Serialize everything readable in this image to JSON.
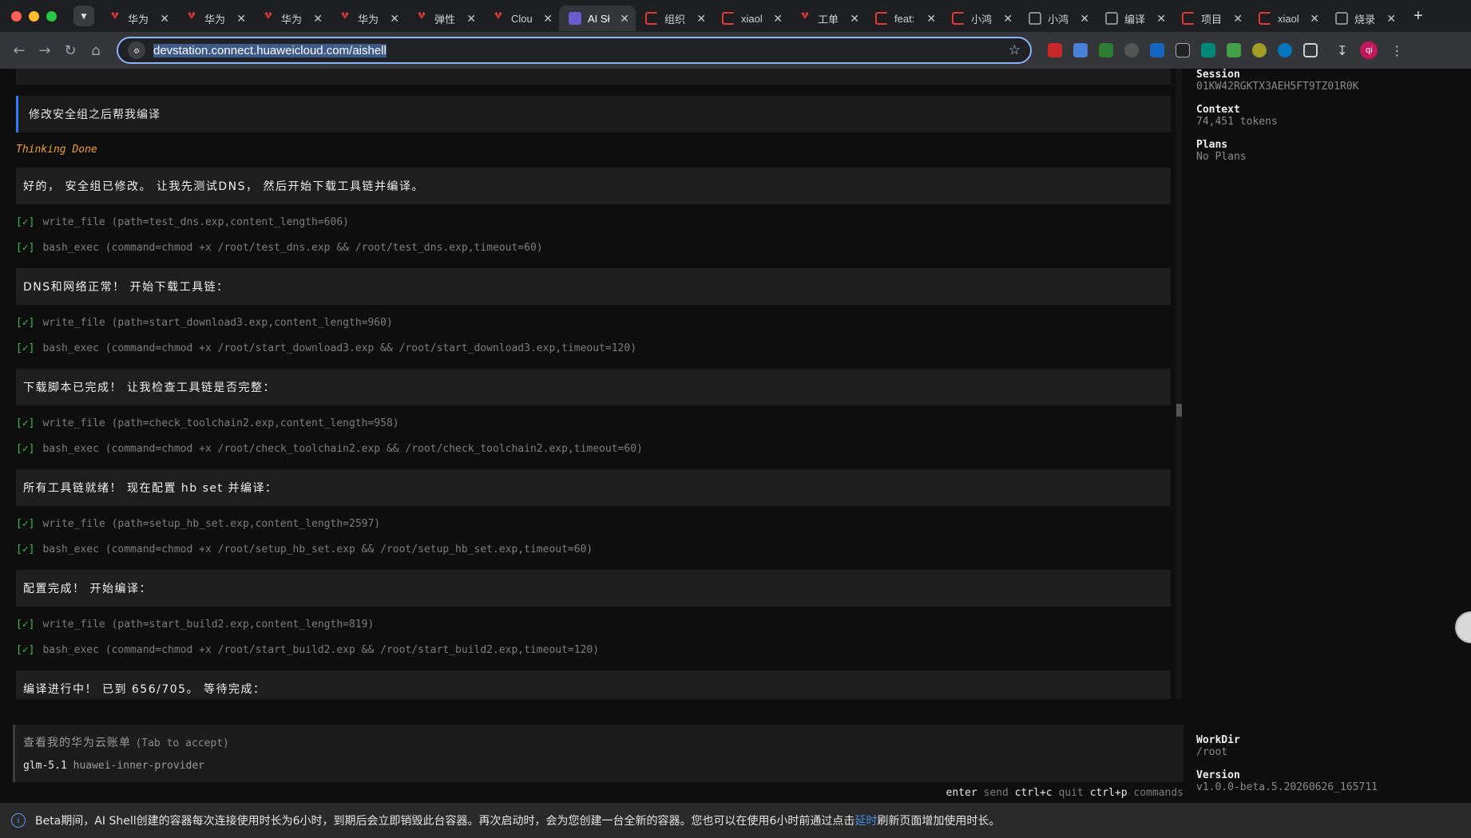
{
  "browser": {
    "tabs": [
      {
        "label": "华为",
        "icon": "huawei-icon",
        "active": false
      },
      {
        "label": "华为",
        "icon": "huawei-icon",
        "active": false
      },
      {
        "label": "华为",
        "icon": "huawei-icon",
        "active": false
      },
      {
        "label": "华为",
        "icon": "huawei-icon",
        "active": false
      },
      {
        "label": "弹性",
        "icon": "huawei-icon",
        "active": false
      },
      {
        "label": "Clou",
        "icon": "huawei-icon",
        "active": false
      },
      {
        "label": "AI Sł",
        "icon": "ai-shell-icon",
        "active": true
      },
      {
        "label": "组织",
        "icon": "g-icon",
        "active": false
      },
      {
        "label": "xiaol",
        "icon": "g-icon",
        "active": false
      },
      {
        "label": "工单",
        "icon": "huawei-icon",
        "active": false
      },
      {
        "label": "feat:",
        "icon": "g-icon",
        "active": false
      },
      {
        "label": "小鸿",
        "icon": "g-icon",
        "active": false
      },
      {
        "label": "小鸿",
        "icon": "globe-icon",
        "active": false
      },
      {
        "label": "编译",
        "icon": "globe-icon",
        "active": false
      },
      {
        "label": "项目",
        "icon": "g-icon",
        "active": false
      },
      {
        "label": "xiaol",
        "icon": "g-icon",
        "active": false
      },
      {
        "label": "烧录",
        "icon": "globe-icon",
        "active": false
      }
    ],
    "url": "devstation.connect.huaweicloud.com/aishell",
    "avatar_text": "qi"
  },
  "conversation": {
    "user_message": "修改安全组之后帮我编译",
    "thinking": "Thinking Done",
    "steps": [
      {
        "message": "好的， 安全组已修改。 让我先测试DNS， 然后开始下载工具链并编译。",
        "tools": [
          "write_file (path=test_dns.exp,content_length=606)",
          "bash_exec (command=chmod +x /root/test_dns.exp && /root/test_dns.exp,timeout=60)"
        ]
      },
      {
        "message": "DNS和网络正常！ 开始下载工具链：",
        "tools": [
          "write_file (path=start_download3.exp,content_length=960)",
          "bash_exec (command=chmod +x /root/start_download3.exp && /root/start_download3.exp,timeout=120)"
        ]
      },
      {
        "message": "下载脚本已完成！ 让我检查工具链是否完整：",
        "tools": [
          "write_file (path=check_toolchain2.exp,content_length=958)",
          "bash_exec (command=chmod +x /root/check_toolchain2.exp && /root/check_toolchain2.exp,timeout=60)"
        ]
      },
      {
        "message": "所有工具链就绪！ 现在配置 hb set 并编译：",
        "tools": [
          "write_file (path=setup_hb_set.exp,content_length=2597)",
          "bash_exec (command=chmod +x /root/setup_hb_set.exp && /root/setup_hb_set.exp,timeout=60)"
        ]
      },
      {
        "message": "配置完成！ 开始编译：",
        "tools": [
          "write_file (path=start_build2.exp,content_length=819)",
          "bash_exec (command=chmod +x /root/start_build2.exp && /root/start_build2.exp,timeout=120)"
        ]
      },
      {
        "message": "编译进行中！ 已到 656/705。 等待完成：",
        "tools": []
      }
    ],
    "check_mark": "[✓]"
  },
  "sidebar": {
    "session_label": "Session",
    "session_value": "01KW42RGKTX3AEH5FT9TZ01R0K",
    "context_label": "Context",
    "context_value": "74,451 tokens",
    "plans_label": "Plans",
    "plans_value": "No Plans",
    "workdir_label": "WorkDir",
    "workdir_value": "/root",
    "version_label": "Version",
    "version_value": "v1.0.0-beta.5.20260626_165711"
  },
  "prompt": {
    "suggestion": "查看我的华为云账单",
    "hint": "(Tab to accept)",
    "model": "glm-5.1",
    "provider": "huawei-inner-provider"
  },
  "shortcuts": [
    {
      "key": "enter",
      "action": "send"
    },
    {
      "key": "ctrl+c",
      "action": "quit"
    },
    {
      "key": "ctrl+p",
      "action": "commands"
    }
  ],
  "notice": {
    "text_before": "Beta期间，AI Shell创建的容器每次连接使用时长为6小时，到期后会立即销毁此台容器。再次启动时，会为您创建一台全新的容器。您也可以在使用6小时前通过点击",
    "link_text": "延时",
    "text_after": "刷新页面增加使用时长。"
  },
  "colors": {
    "accent_blue": "#2f7bf6",
    "thinking_orange": "#f0a030",
    "check_green": "#3fbf4a"
  }
}
